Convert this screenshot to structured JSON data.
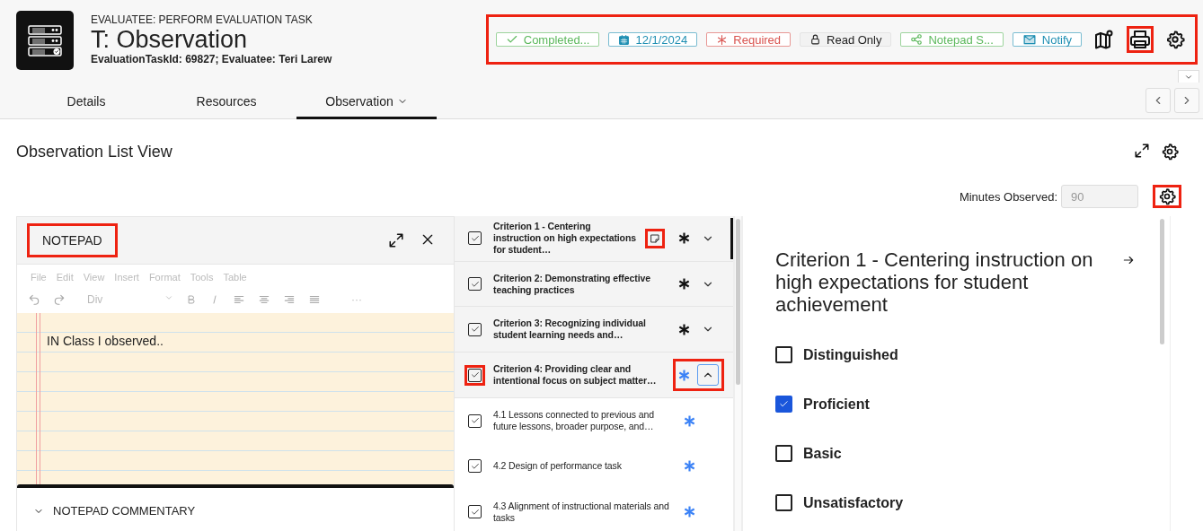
{
  "header": {
    "overline": "EVALUATEE: PERFORM EVALUATION TASK",
    "title": "T: Observation",
    "subtitle": "EvaluationTaskId: 69827; Evaluatee: Teri Larew"
  },
  "toolbar": {
    "highlighted": true,
    "chips": [
      {
        "kind": "check",
        "label": "Completed...",
        "color": "#5cb85c"
      },
      {
        "kind": "calendar",
        "label": "12/1/2024",
        "color": "#1f8fb3"
      },
      {
        "kind": "asterisk",
        "label": "Required",
        "color": "#d9534f"
      },
      {
        "kind": "lock",
        "label": "Read Only",
        "color": "#222222"
      },
      {
        "kind": "share",
        "label": "Notepad S...",
        "color": "#5cb85c"
      },
      {
        "kind": "mail",
        "label": "Notify",
        "color": "#1f8fb3"
      }
    ],
    "icons": [
      {
        "kind": "map",
        "highlighted": false
      },
      {
        "kind": "print",
        "highlighted": true
      },
      {
        "kind": "settings",
        "highlighted": false
      }
    ]
  },
  "panel_toggle": {
    "expanded": false
  },
  "tabs": [
    {
      "label": "Details",
      "selected": false,
      "dropdown": false
    },
    {
      "label": "Resources",
      "selected": false,
      "dropdown": false
    },
    {
      "label": "Observation",
      "selected": true,
      "dropdown": true
    }
  ],
  "section": {
    "title": "Observation List View",
    "minutes_label": "Minutes Observed:",
    "minutes_value": "90",
    "settings_highlighted": true
  },
  "notepad": {
    "title": "NOTEPAD",
    "title_highlighted": true,
    "menu": [
      "File",
      "Edit",
      "View",
      "Insert",
      "Format",
      "Tools",
      "Table"
    ],
    "style_select": "Div",
    "more": "···",
    "text": "IN Class I observed..",
    "commentary": "NOTEPAD COMMENTARY"
  },
  "criteria": [
    {
      "kind": "criterion",
      "text": "Criterion 1 - Centering instruction on high expectations for student…",
      "checked": true,
      "selected": true,
      "expanded": false,
      "has_note": true,
      "note_highlighted": true,
      "checkbox_highlighted": false,
      "controls_highlighted": false,
      "color": "#111111"
    },
    {
      "kind": "criterion",
      "text": "Criterion 2: Demonstrating effective teaching practices",
      "checked": true,
      "selected": false,
      "expanded": false,
      "has_note": false,
      "checkbox_highlighted": false,
      "controls_highlighted": false,
      "color": "#111111"
    },
    {
      "kind": "criterion",
      "text": "Criterion 3: Recognizing individual student learning needs and…",
      "checked": true,
      "selected": false,
      "expanded": false,
      "has_note": false,
      "checkbox_highlighted": false,
      "controls_highlighted": false,
      "color": "#111111"
    },
    {
      "kind": "criterion",
      "text": "Criterion 4: Providing clear and intentional focus on subject matter…",
      "checked": true,
      "selected": false,
      "expanded": true,
      "has_note": false,
      "checkbox_highlighted": true,
      "controls_highlighted": true,
      "color": "#3b82f6"
    },
    {
      "kind": "indicator",
      "text": "4.1 Lessons connected to previous and future lessons, broader purpose, and…",
      "checked": true,
      "selected": false,
      "has_note": false,
      "checkbox_highlighted": false,
      "controls_highlighted": false,
      "color": "#3b82f6"
    },
    {
      "kind": "indicator",
      "text": "4.2 Design of performance task",
      "checked": true,
      "selected": false,
      "has_note": false,
      "checkbox_highlighted": false,
      "controls_highlighted": false,
      "color": "#3b82f6"
    },
    {
      "kind": "indicator",
      "text": "4.3 Alignment of instructional materials and tasks",
      "checked": true,
      "selected": false,
      "has_note": false,
      "checkbox_highlighted": false,
      "controls_highlighted": false,
      "color": "#3b82f6"
    }
  ],
  "detail": {
    "title": "Criterion 1 - Centering instruction on high expectations for student achievement",
    "options": [
      {
        "label": "Distinguished",
        "checked": false
      },
      {
        "label": "Proficient",
        "checked": true
      },
      {
        "label": "Basic",
        "checked": false
      },
      {
        "label": "Unsatisfactory",
        "checked": false
      }
    ]
  }
}
